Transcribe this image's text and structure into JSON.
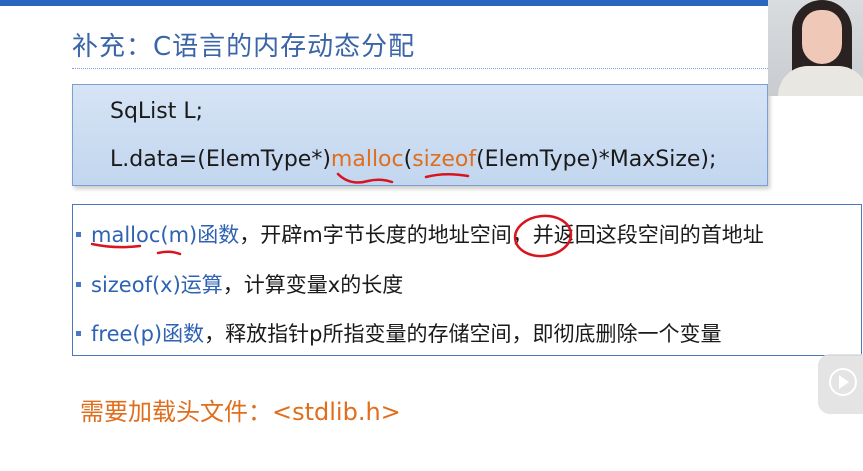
{
  "slide": {
    "title": "补充：C语言的内存动态分配"
  },
  "code": {
    "line1": "SqList L;",
    "line2_pre": "L.data=(ElemType*)",
    "line2_fn1": "malloc",
    "line2_paren": "(",
    "line2_fn2": "sizeof",
    "line2_post": "(ElemType)*MaxSize);"
  },
  "list": {
    "item1_blue": "malloc(m)函数",
    "item1_rest": "，开辟m字节长度的地址空间，并返回这段空间的首地址",
    "item2_blue": "sizeof(x)运算",
    "item2_rest": "，计算变量x的长度",
    "item3_blue": "free(p)函数",
    "item3_rest": "，释放指针p所指变量的存储空间，即彻底删除一个变量"
  },
  "footer": {
    "note": "需要加载头文件：<stdlib.h>"
  },
  "colors": {
    "title": "#3a65a8",
    "accent_orange": "#e06e1c",
    "accent_blue": "#2e62b3",
    "annotation_red": "#d8141e",
    "code_box_bg": "#cddcf2"
  },
  "icons": {
    "play": "play-circle-icon"
  }
}
